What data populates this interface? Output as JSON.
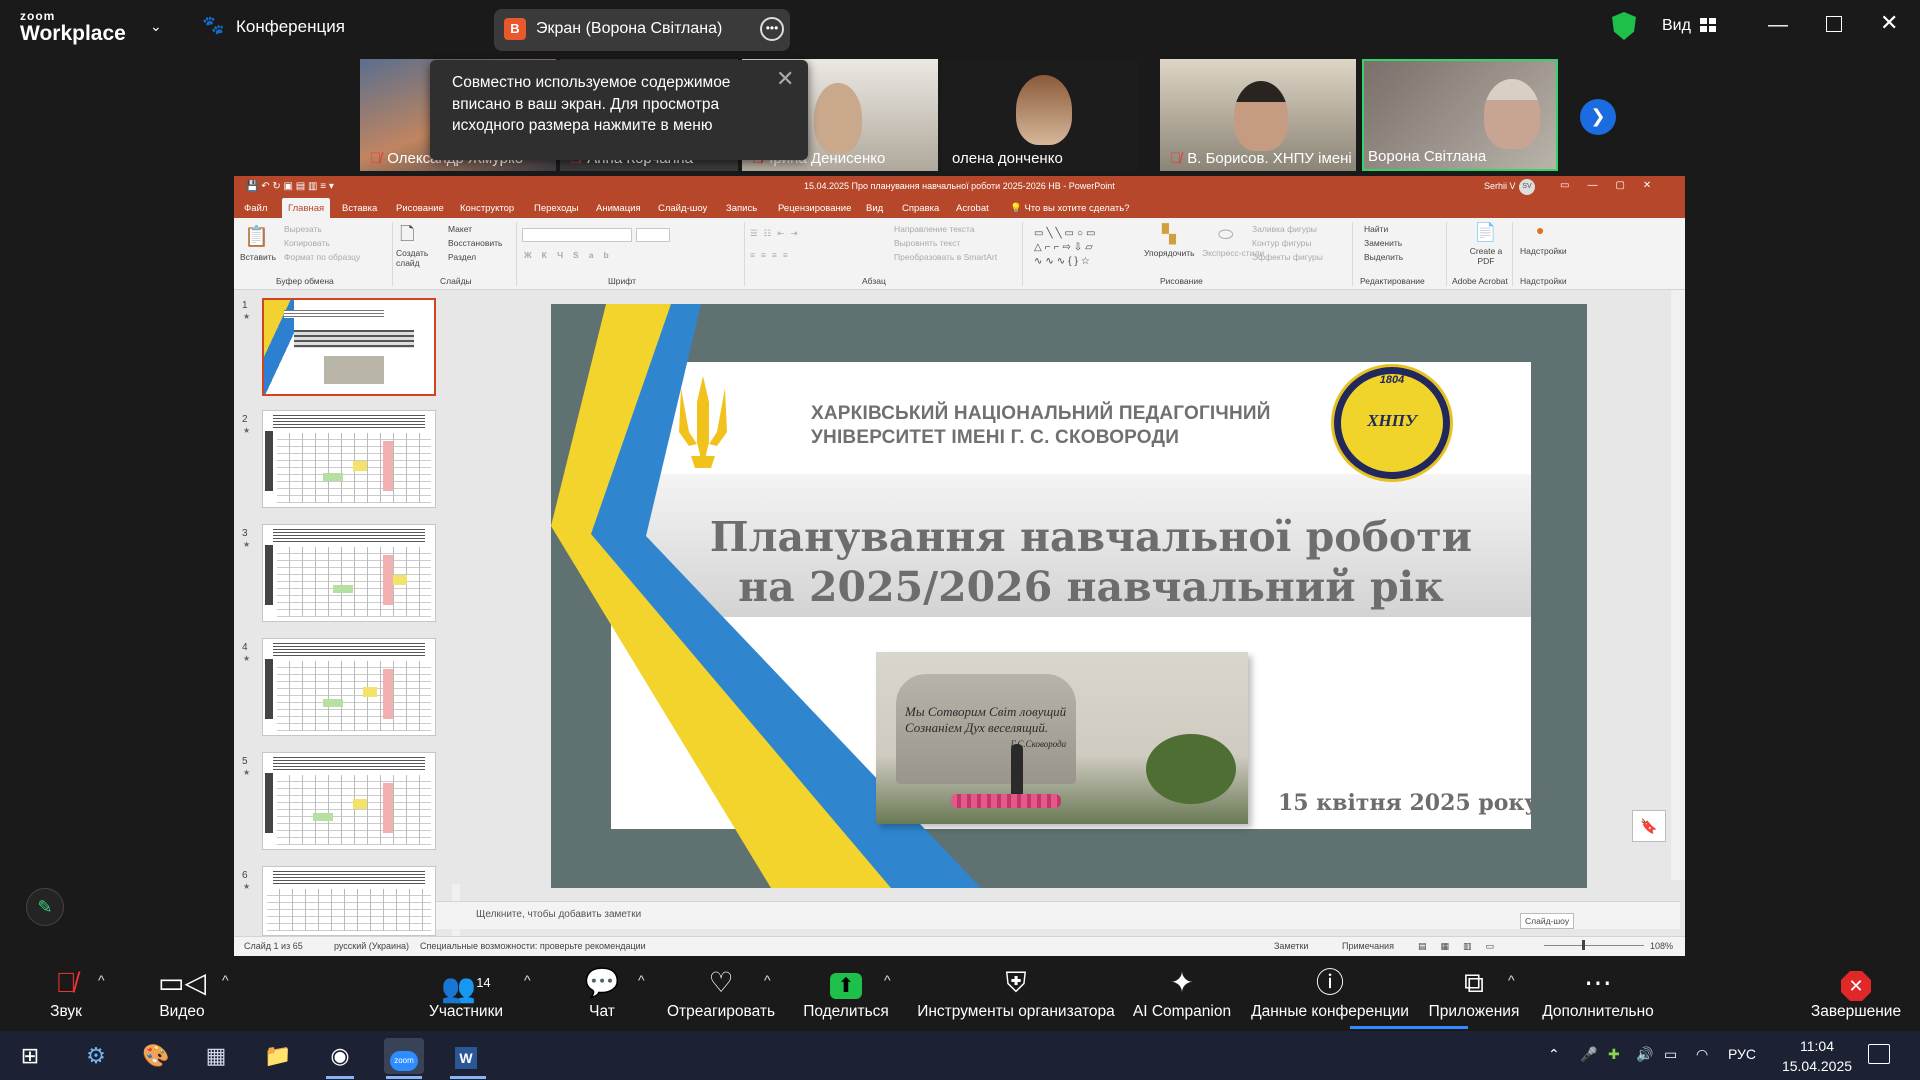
{
  "window": {
    "logo_top": "zoom",
    "logo_bottom": "Workplace",
    "meeting_label": "Конференция",
    "share_badge": "В",
    "share_label": "Экран (Ворона Світлана)",
    "view_label": "Вид"
  },
  "gallery": {
    "participants": [
      {
        "name": "Олександр Жмурко",
        "muted": true
      },
      {
        "name": "Анна Корчагіна",
        "muted": true
      },
      {
        "name": "Ірина Денисенко",
        "muted": true
      },
      {
        "name": "олена донченко",
        "muted": false
      },
      {
        "name": "В. Борисов. ХНПУ імені",
        "muted": true
      },
      {
        "name": "Ворона Світлана",
        "muted": false
      }
    ],
    "tooltip": "Совместно используемое содержимое вписано в ваш экран. Для просмотра исходного размера нажмите в меню"
  },
  "powerpoint": {
    "title": "15.04.2025 Про планування навчальної роботи 2025-2026 НВ  -  PowerPoint",
    "user": "Serhii V",
    "user_initials": "SV",
    "tabs": [
      "Файл",
      "Главная",
      "Вставка",
      "Рисование",
      "Конструктор",
      "Переходы",
      "Анимация",
      "Слайд-шоу",
      "Запись",
      "Рецензирование",
      "Вид",
      "Справка",
      "Acrobat"
    ],
    "tell_me": "Что вы хотите сделать?",
    "ribbon": {
      "paste": "Вставить",
      "cut": "Вырезать",
      "copy": "Копировать",
      "format_painter": "Формат по образцу",
      "clipboard_group": "Буфер обмена",
      "new_slide": "Создать слайд",
      "layout": "Макет",
      "reset": "Восстановить",
      "section": "Раздел",
      "slides_group": "Слайды",
      "font_group": "Шрифт",
      "text_dir": "Направление текста",
      "align_text": "Выровнять текст",
      "smartart": "Преобразовать в SmartArt",
      "paragraph_group": "Абзац",
      "arrange": "Упорядочить",
      "quick_styles": "Экспресс-стили",
      "shape_fill": "Заливка фигуры",
      "shape_outline": "Контур фигуры",
      "shape_effects": "Эффекты фигуры",
      "drawing_group": "Рисование",
      "find": "Найти",
      "replace": "Заменить",
      "select": "Выделить",
      "editing_group": "Редактирование",
      "create_pdf": "Create a PDF",
      "acrobat_group": "Adobe Acrobat",
      "addins": "Надстройки",
      "addins_group": "Надстройки"
    },
    "thumbnails": [
      "1",
      "2",
      "3",
      "4",
      "5",
      "6"
    ],
    "thumb_side_label": "Вступ-2026",
    "slide": {
      "university_line1": "ХАРКІВСЬКИЙ НАЦІОНАЛЬНИЙ ПЕДАГОГІЧНИЙ",
      "university_line2": "УНІВЕРСИТЕТ ІМЕНІ Г. С. СКОВОРОДИ",
      "seal_year": "1804",
      "seal_text": "ХНПУ",
      "title_line1": "Планування навчальної роботи",
      "title_line2": "на 2025/2026 навчальний рік",
      "photo_inscription_1": "Мы Сотворим Світ  ловущий",
      "photo_inscription_2": "Сознаніем Дух веселящий.",
      "photo_inscription_3": "Г.С.Сковорода",
      "date": "15 квітня 2025 року"
    },
    "notes_placeholder": "Щелкните, чтобы добавить заметки",
    "slideshow_tooltip": "Слайд-шоу",
    "status": {
      "slide_count": "Слайд 1 из 65",
      "language": "русский (Украина)",
      "accessibility": "Специальные возможности: проверьте рекомендации",
      "notes": "Заметки",
      "comments": "Примечания",
      "zoom": "108%"
    }
  },
  "toolbar": {
    "audio": "Звук",
    "video": "Видео",
    "participants": "Участники",
    "participants_count": "14",
    "chat": "Чат",
    "react": "Отреагировать",
    "share": "Поделиться",
    "host_tools": "Инструменты организатора",
    "ai": "AI Companion",
    "info": "Данные конференции",
    "apps": "Приложения",
    "more": "Дополнительно",
    "end": "Завершение"
  },
  "taskbar": {
    "lang": "РУС",
    "time": "11:04",
    "date": "15.04.2025"
  },
  "colors": {
    "ppt_accent": "#b7472a",
    "zoom_blue": "#2d8cff",
    "share_green": "#1fbf4b",
    "end_red": "#e02828",
    "slide_bg": "#5f7170"
  }
}
